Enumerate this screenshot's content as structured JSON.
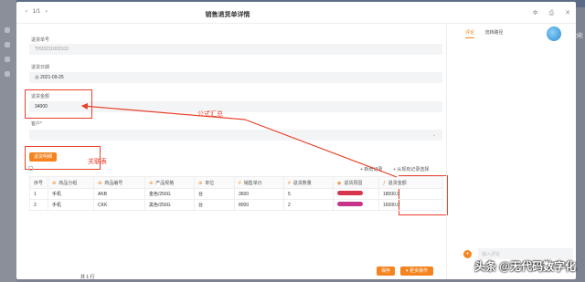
{
  "window": {
    "nav_counter": "1/1",
    "title": "销售退货单详情"
  },
  "form": {
    "order_no_label": "退货单号",
    "order_no_value": "TH20211002103",
    "date_label": "退货日期",
    "date_value": "2021-09-25",
    "amount_label": "退货金额",
    "amount_value": "34000",
    "customer_label": "客户*",
    "customer_placeholder": ""
  },
  "annotations": {
    "formula_label": "公式汇总",
    "related_table_label": "关联表"
  },
  "detail": {
    "button_label": "退货明细",
    "add_record_label": "新增记录",
    "select_existing_label": "从现有记录选择",
    "columns": [
      "序号",
      "商品分组",
      "商品编号",
      "产品规格",
      "单位",
      "销售单价",
      "退货数量",
      "退货原因",
      "退货金额"
    ],
    "rows": [
      {
        "index": "1",
        "group": "手机",
        "code": "AKB",
        "spec": "金色/256G",
        "unit": "台",
        "price": "3600",
        "qty": "5",
        "reason_color": "#d9344d",
        "amount": "18000.0"
      },
      {
        "index": "2",
        "group": "手机",
        "code": "CKK",
        "spec": "黑色/256G",
        "unit": "台",
        "price": "8000",
        "qty": "2",
        "reason_color": "#c8338a",
        "amount": "16000.0"
      }
    ]
  },
  "footer": {
    "save_label": "保存",
    "more_label": "更多操作",
    "page_info": "共 1 行"
  },
  "side": {
    "tabs": [
      "评论",
      "流转路径"
    ],
    "comment_placeholder": "输入评论"
  },
  "background": {
    "right_text": "记功能"
  },
  "watermark": "头条 @无代码数字化",
  "colors": {
    "accent": "#f5841f",
    "annotation": "#e8402c"
  }
}
